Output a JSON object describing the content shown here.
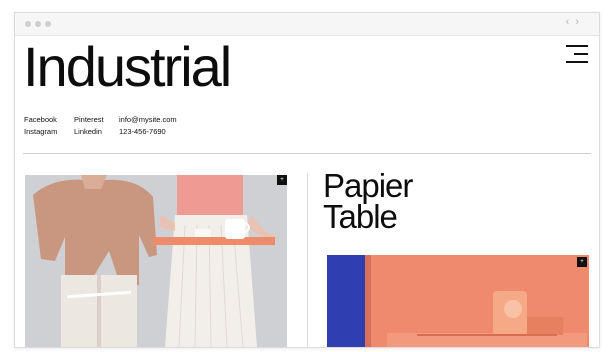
{
  "site": {
    "title": "Industrial"
  },
  "window": {
    "nav_prev": "‹",
    "nav_next": "›"
  },
  "contact": {
    "col1": [
      "Facebook",
      "Instagram"
    ],
    "col2": [
      "Pinterest",
      "Linkedin"
    ],
    "col3": [
      "info@mysite.com",
      "123-456-7690"
    ]
  },
  "product": {
    "title_line1": "Papier",
    "title_line2": "Table"
  },
  "gallery": {
    "expand_glyph": "+"
  },
  "colors": {
    "background": "#ffffff",
    "text": "#111111",
    "photo_left_bg": "#cfd0d3",
    "photo_right_bg": "#f08a6c",
    "photo_right_accent": "#2f3fb2"
  },
  "icons": {
    "menu": "hamburger-menu-icon",
    "expand": "plus-icon"
  }
}
